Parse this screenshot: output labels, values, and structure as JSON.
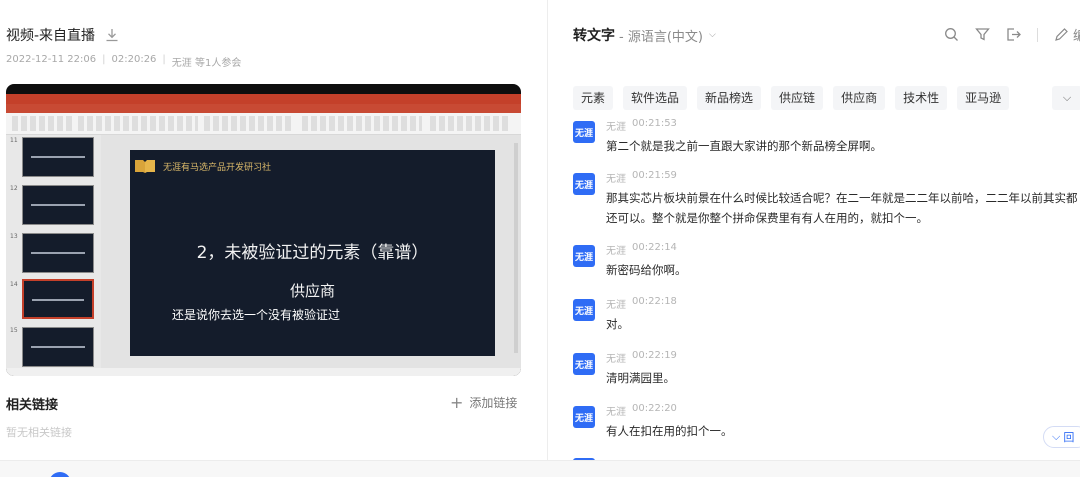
{
  "video": {
    "title": "视频-来自直播",
    "date": "2022-12-11 22:06",
    "duration": "02:20:26",
    "participants": "无涯 等1人参会",
    "slide": {
      "org": "无涯有马选产品开发研习社",
      "heading": "2，未被验证过的元素（靠谱）",
      "subheading": "供应商",
      "caption": "还是说你去选一个没有被验证过"
    }
  },
  "links": {
    "title": "相关链接",
    "add_label": "添加链接",
    "empty": "暂无相关链接"
  },
  "transcript": {
    "title": "转文字",
    "source": "- 源语言(中文)",
    "edit_label": "编辑",
    "tags": [
      "元素",
      "软件选品",
      "新品榜选",
      "供应链",
      "供应商",
      "技术性",
      "亚马逊"
    ],
    "messages": [
      {
        "avatar": "无涯",
        "speaker": "无涯",
        "time": "00:21:53",
        "lines": [
          "第二个就是我之前一直跟大家讲的那个新品榜全屏啊。"
        ]
      },
      {
        "avatar": "无涯",
        "speaker": "无涯",
        "time": "00:21:59",
        "lines": [
          "那其实芯片板块前景在什么时候比较适合呢？在二一年就是二二年以前哈，二二年以前其实都",
          "还可以。整个就是你整个拼命保费里有有人在用的，就扣个一。"
        ]
      },
      {
        "avatar": "无涯",
        "speaker": "无涯",
        "time": "00:22:14",
        "lines": [
          "新密码给你啊。"
        ]
      },
      {
        "avatar": "无涯",
        "speaker": "无涯",
        "time": "00:22:18",
        "lines": [
          "对。"
        ]
      },
      {
        "avatar": "无涯",
        "speaker": "无涯",
        "time": "00:22:19",
        "lines": [
          "清明满园里。"
        ]
      },
      {
        "avatar": "无涯",
        "speaker": "无涯",
        "time": "00:22:20",
        "lines": [
          "有人在扣在用的扣个一。"
        ]
      }
    ],
    "back_label": "回"
  },
  "colors": {
    "accent": "#2f6cf5",
    "ppt_red": "#c4402a",
    "slide_bg": "#141c2b"
  }
}
